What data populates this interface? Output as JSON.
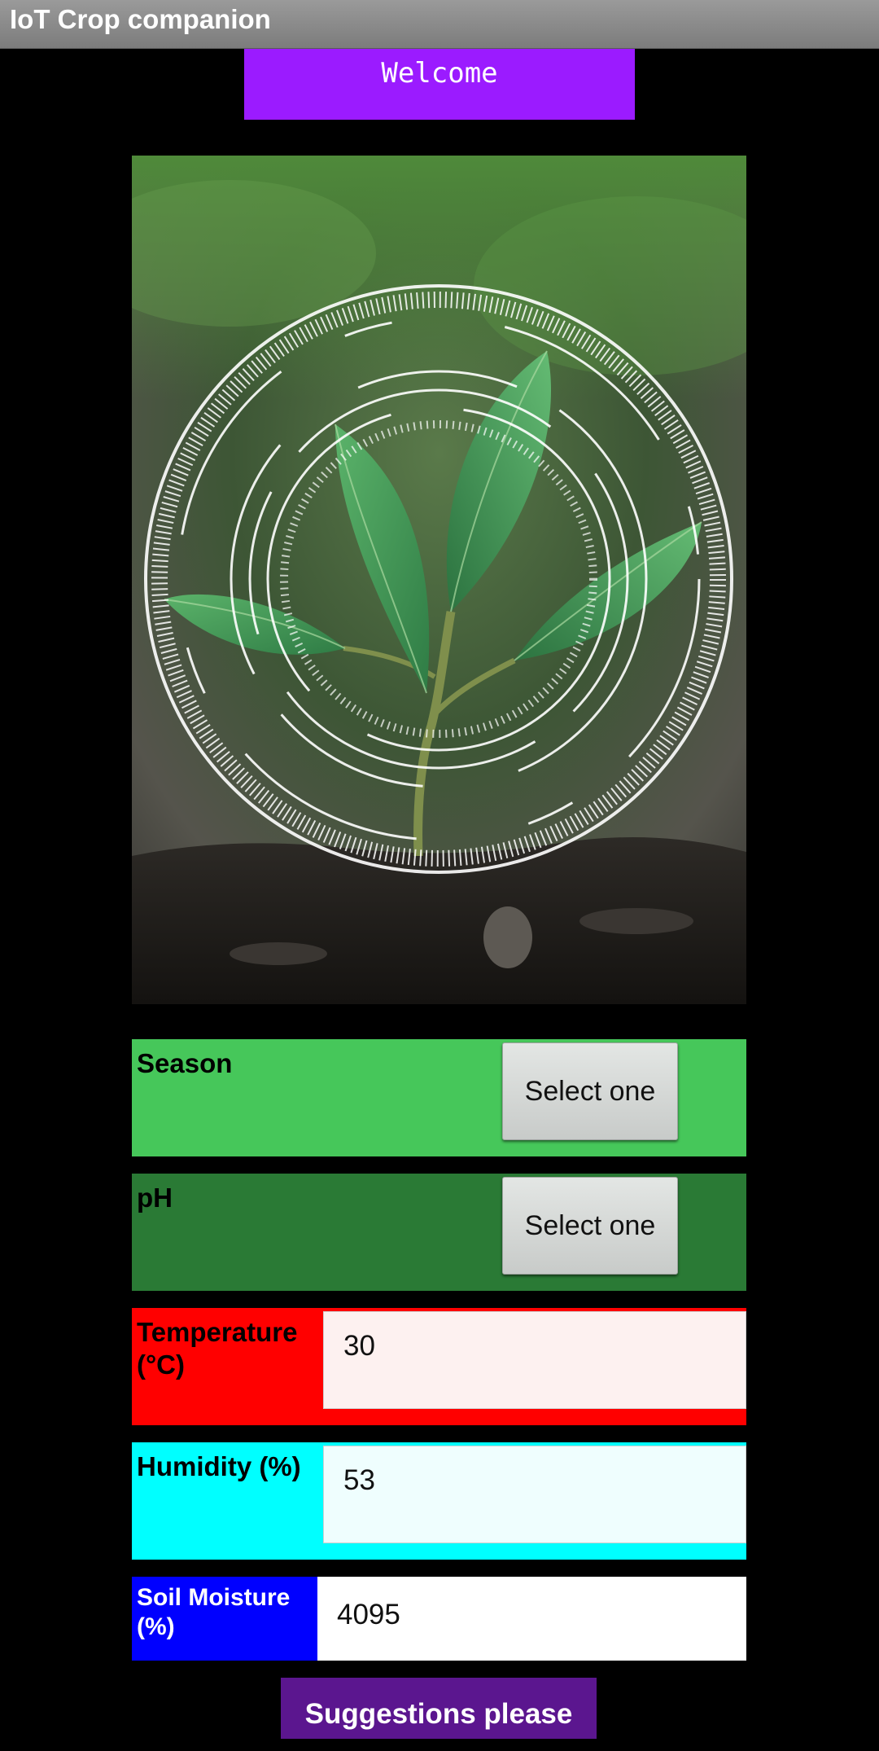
{
  "app": {
    "title": "IoT Crop companion"
  },
  "welcome": {
    "label": "Welcome"
  },
  "hero_image": {
    "subject": "seedling-with-circular-tech-overlay"
  },
  "form": {
    "season": {
      "label": "Season",
      "selected": "Select one",
      "color": "#46c75a"
    },
    "ph": {
      "label": "pH",
      "selected": "Select one",
      "color": "#2a7a35"
    },
    "temperature": {
      "label_line1": "Temperature",
      "label_line2": "(°C)",
      "value": "30",
      "color": "#ff0000",
      "field_bg": "#fdf1f0"
    },
    "humidity": {
      "label": "Humidity (%)",
      "value": "53",
      "color": "#00ffff",
      "field_bg": "#effefe"
    },
    "soil_moisture": {
      "label_line1": "Soil Moisture",
      "label_line2": "(%)",
      "value": "4095",
      "color": "#0000ff"
    }
  },
  "actions": {
    "suggest_label": "Suggestions please"
  },
  "colors": {
    "welcome_bg": "#9b1bff",
    "suggest_bg": "#5b168f",
    "background": "#000000"
  }
}
